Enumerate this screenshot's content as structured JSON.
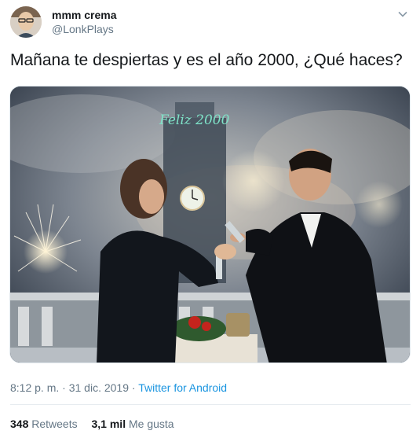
{
  "user": {
    "display_name": "mmm crema",
    "handle": "@LonkPlays"
  },
  "tweet": {
    "text": "Mañana te despiertas y es el año 2000, ¿Qué haces?",
    "media_sign_text": "Feliz 2000",
    "time": "8:12 p. m.",
    "separator": "·",
    "date": "31 dic. 2019",
    "source": "Twitter for Android"
  },
  "stats": {
    "retweets_count": "348",
    "retweets_label": "Retweets",
    "likes_count": "3,1 mil",
    "likes_label": "Me gusta"
  },
  "icons": {
    "menu": "chevron-down-icon"
  },
  "colors": {
    "link": "#1b95e0",
    "muted": "#657786",
    "text": "#14171a",
    "neon_sign": "#7fe3c8"
  }
}
